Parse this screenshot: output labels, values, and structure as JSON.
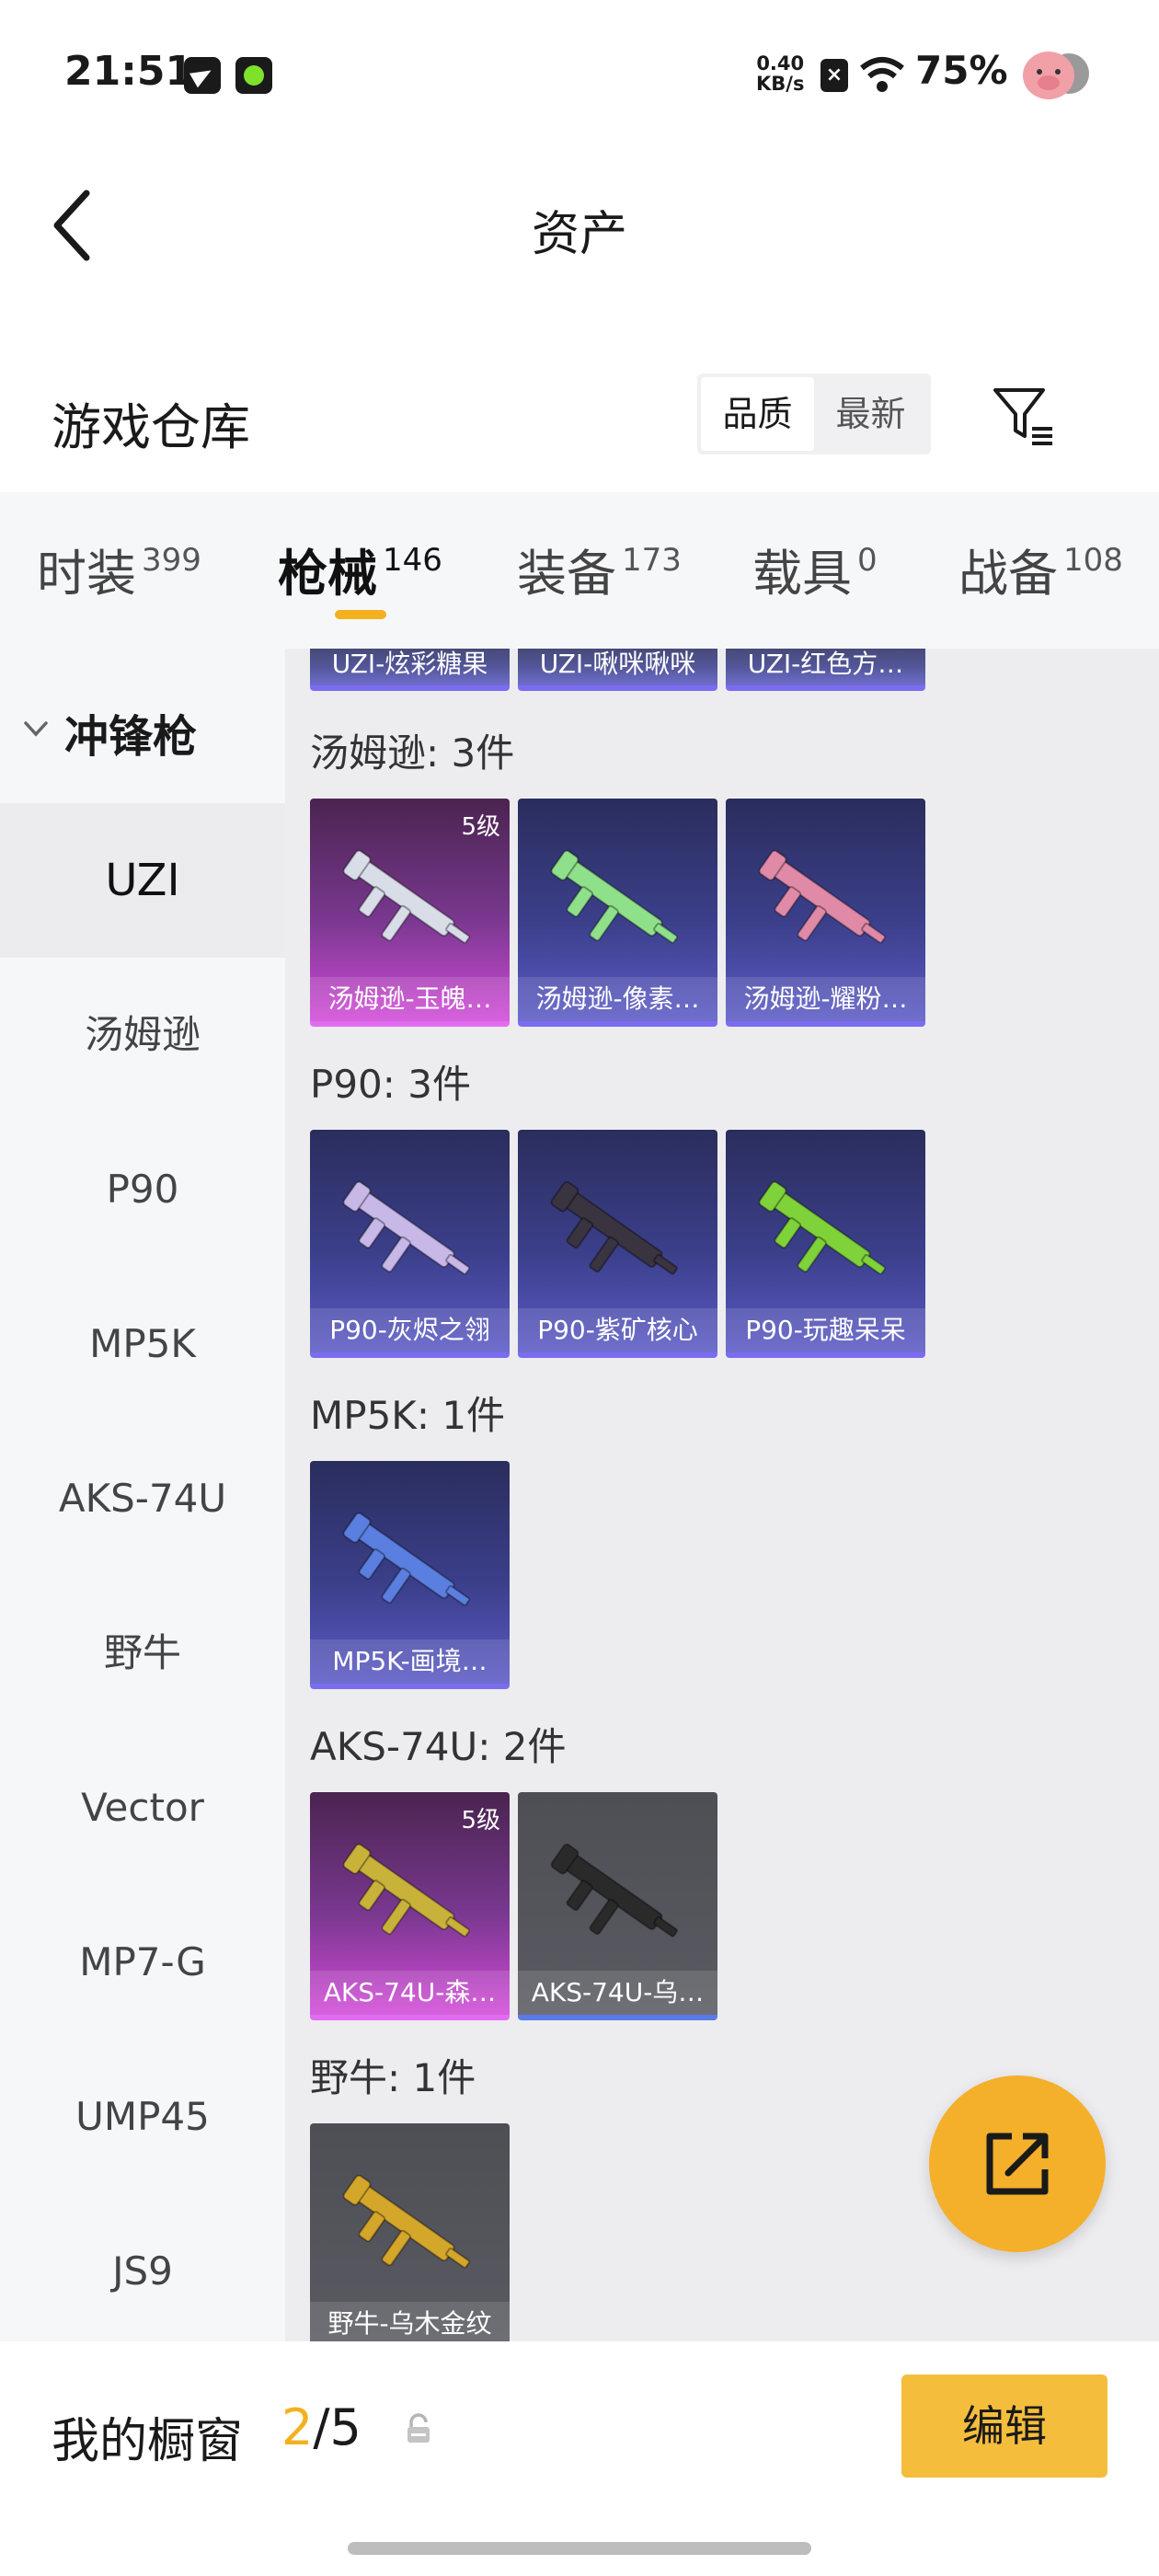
{
  "status_bar": {
    "time": "21:51",
    "net_speed_value": "0.40",
    "net_speed_unit": "KB/s",
    "battery": "75%",
    "icons": [
      "telegram-icon",
      "game-icon",
      "sim-off-icon",
      "wifi-icon",
      "pig-avatar-icon"
    ]
  },
  "header": {
    "title": "资产",
    "back_icon": "chevron-left-icon"
  },
  "section": {
    "title": "游戏仓库",
    "sort_options": [
      "品质",
      "最新"
    ],
    "sort_selected": "品质",
    "filter_icon": "filter-icon"
  },
  "tabs": [
    {
      "label": "时装",
      "count": "399"
    },
    {
      "label": "枪械",
      "count": "146",
      "active": true
    },
    {
      "label": "装备",
      "count": "173"
    },
    {
      "label": "载具",
      "count": "0"
    },
    {
      "label": "战备",
      "count": "108"
    }
  ],
  "sidebar": {
    "group": "冲锋枪",
    "items": [
      "UZI",
      "汤姆逊",
      "P90",
      "MP5K",
      "AKS-74U",
      "野牛",
      "Vector",
      "MP7-G",
      "UMP45",
      "JS9"
    ],
    "active": "UZI"
  },
  "content": {
    "partial_row": [
      "UZI-炫彩糖果",
      "UZI-啾咪啾咪",
      "UZI-红色方…"
    ],
    "groups": [
      {
        "label": "汤姆逊: 3件",
        "items": [
          {
            "name": "汤姆逊-玉魄…",
            "level": "5级",
            "rarity": "legend",
            "gun_color": "#d8dde8"
          },
          {
            "name": "汤姆逊-像素…",
            "level": "",
            "rarity": "epic",
            "gun_color": "#8fe08a"
          },
          {
            "name": "汤姆逊-耀粉…",
            "level": "",
            "rarity": "epic",
            "gun_color": "#e08aa8"
          }
        ]
      },
      {
        "label": "P90: 3件",
        "items": [
          {
            "name": "P90-灰烬之翎",
            "level": "",
            "rarity": "epic",
            "gun_color": "#c7b8e8"
          },
          {
            "name": "P90-紫矿核心",
            "level": "",
            "rarity": "epic",
            "gun_color": "#3a3340"
          },
          {
            "name": "P90-玩趣呆呆",
            "level": "",
            "rarity": "epic",
            "gun_color": "#7fd23a"
          }
        ]
      },
      {
        "label": "MP5K: 1件",
        "items": [
          {
            "name": "MP5K-画境…",
            "level": "",
            "rarity": "epic",
            "gun_color": "#5a7fe0"
          }
        ]
      },
      {
        "label": "AKS-74U: 2件",
        "items": [
          {
            "name": "AKS-74U-森…",
            "level": "5级",
            "rarity": "legend",
            "gun_color": "#c9b23a"
          },
          {
            "name": "AKS-74U-乌…",
            "level": "",
            "rarity": "gray",
            "gun_color": "#2a2a2a"
          }
        ]
      },
      {
        "label": "野牛: 1件",
        "items": [
          {
            "name": "野牛-乌木金纹",
            "level": "",
            "rarity": "gray",
            "gun_color": "#d4a62a"
          }
        ]
      }
    ]
  },
  "fab_icon": "share-out-icon",
  "bottom": {
    "label": "我的橱窗",
    "count_current": "2",
    "count_total": "/5",
    "lock_icon": "lock-icon",
    "edit_label": "编辑"
  }
}
